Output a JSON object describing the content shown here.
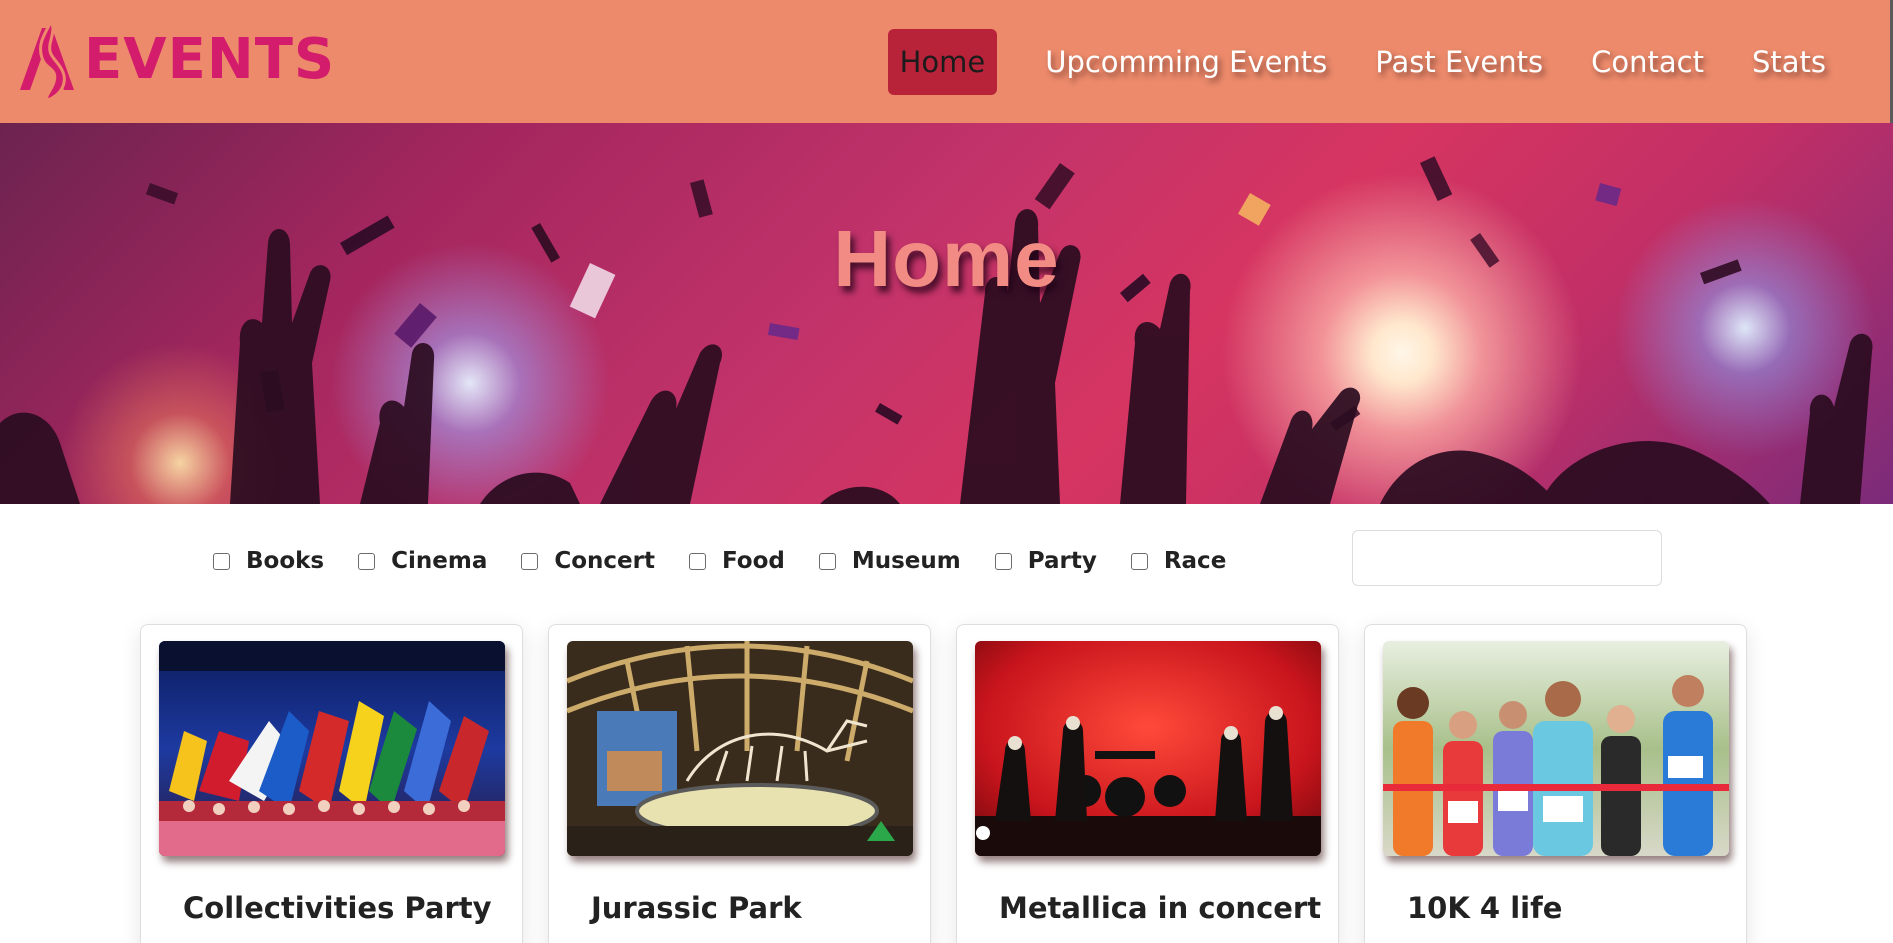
{
  "app": {
    "logo_text": "EVENTS",
    "logo_mark": "A",
    "brand_color": "#d41c6c",
    "header_color": "#ec8a6b"
  },
  "nav": {
    "items": [
      {
        "label": "Home",
        "active": true
      },
      {
        "label": "Upcomming Events",
        "active": false
      },
      {
        "label": "Past Events",
        "active": false
      },
      {
        "label": "Contact",
        "active": false
      },
      {
        "label": "Stats",
        "active": false
      }
    ],
    "active_color": "#b8233a"
  },
  "hero": {
    "title": "Home",
    "image": "concert-crowd-confetti"
  },
  "filters": {
    "categories": [
      {
        "label": "Books",
        "checked": false
      },
      {
        "label": "Cinema",
        "checked": false
      },
      {
        "label": "Concert",
        "checked": false
      },
      {
        "label": "Food",
        "checked": false
      },
      {
        "label": "Museum",
        "checked": false
      },
      {
        "label": "Party",
        "checked": false
      },
      {
        "label": "Race",
        "checked": false
      }
    ],
    "search": {
      "value": "",
      "placeholder": ""
    }
  },
  "cards": [
    {
      "title": "Collectivities Party",
      "image": "flags-parade-stage"
    },
    {
      "title": "Jurassic Park",
      "image": "dinosaur-skeleton-museum"
    },
    {
      "title": "Metallica in concert",
      "image": "rock-band-stage"
    },
    {
      "title": "10K 4 life",
      "image": "runners-finish-line"
    }
  ]
}
